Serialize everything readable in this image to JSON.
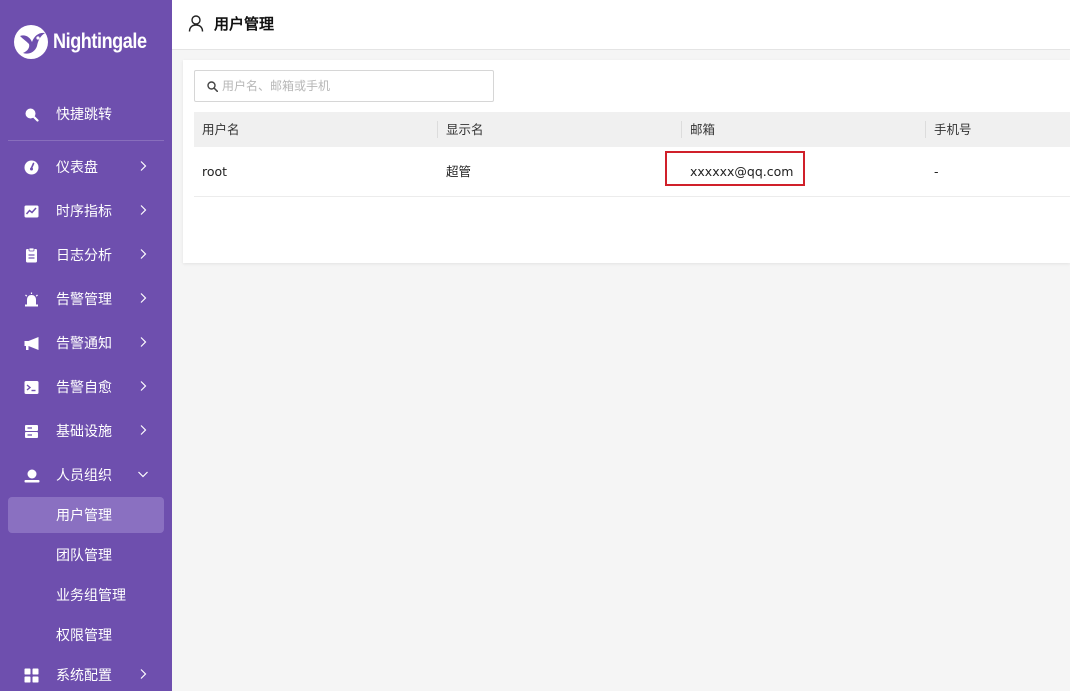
{
  "brand": {
    "name": "Nightingale"
  },
  "sidebar": {
    "quick_jump": {
      "label": "快捷跳转",
      "icon": "search-icon"
    },
    "items": [
      {
        "label": "仪表盘",
        "icon": "dashboard-icon"
      },
      {
        "label": "时序指标",
        "icon": "line-chart-icon"
      },
      {
        "label": "日志分析",
        "icon": "document-icon"
      },
      {
        "label": "告警管理",
        "icon": "alarm-bell-icon"
      },
      {
        "label": "告警通知",
        "icon": "megaphone-icon"
      },
      {
        "label": "告警自愈",
        "icon": "terminal-icon"
      },
      {
        "label": "基础设施",
        "icon": "server-icon"
      },
      {
        "label": "人员组织",
        "icon": "user-icon",
        "expanded": true
      }
    ],
    "sub_items": [
      {
        "label": "用户管理",
        "active": true
      },
      {
        "label": "团队管理"
      },
      {
        "label": "业务组管理"
      },
      {
        "label": "权限管理"
      }
    ],
    "bottom_item": {
      "label": "系统配置",
      "icon": "grid-icon"
    }
  },
  "header": {
    "title": "用户管理",
    "icon": "user-outline-icon"
  },
  "search": {
    "placeholder": "用户名、邮箱或手机"
  },
  "table": {
    "columns": [
      "用户名",
      "显示名",
      "邮箱",
      "手机号"
    ],
    "rows": [
      {
        "username": "root",
        "display_name": "超管",
        "email": "xxxxxx@qq.com",
        "phone": "-"
      }
    ]
  },
  "colors": {
    "sidebar_bg": "#6e4fae",
    "active_item_bg": "#8a70c1",
    "highlight_border": "#d0202a"
  }
}
